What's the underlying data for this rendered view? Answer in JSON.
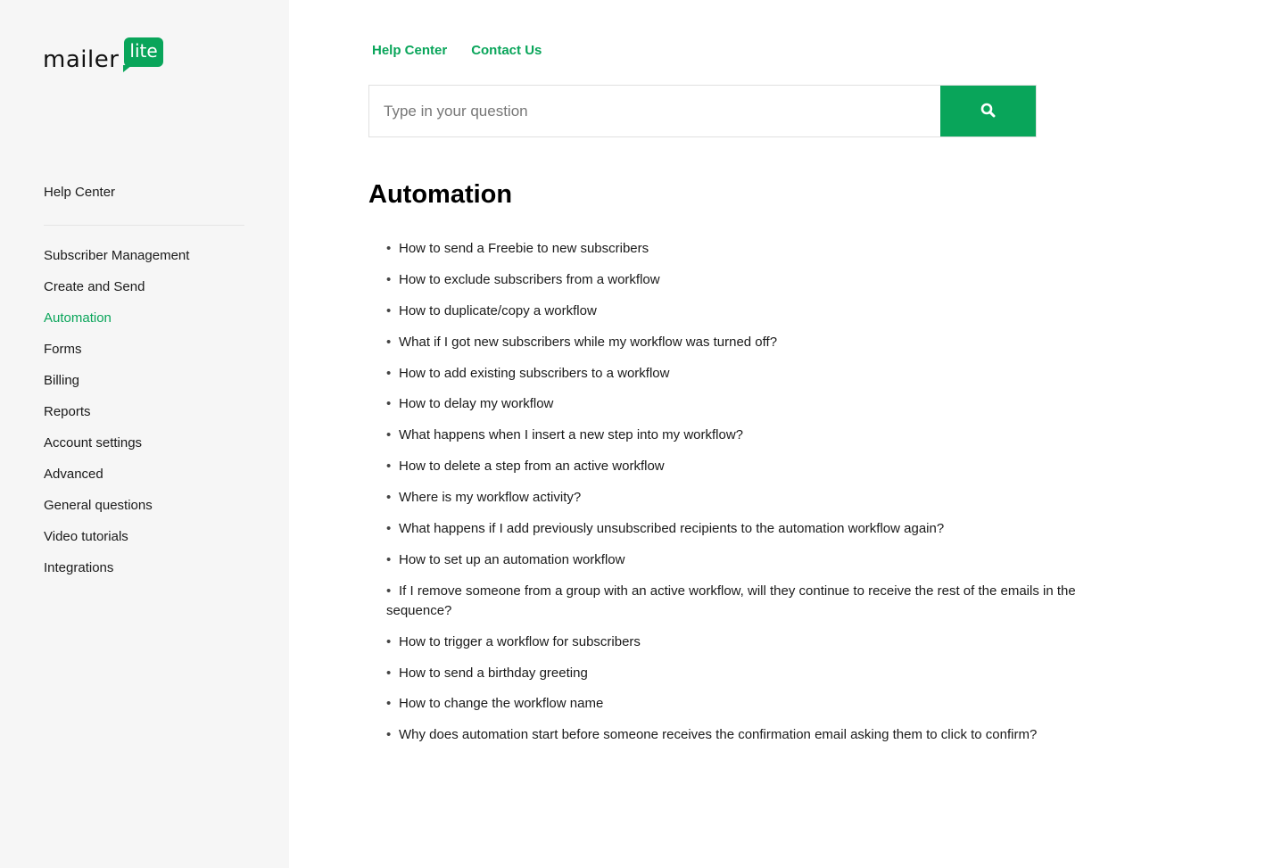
{
  "brand": {
    "word": "mailer",
    "badge": "lite",
    "accent_color": "#09a55a"
  },
  "sidebar": {
    "home_label": "Help Center",
    "items": [
      {
        "label": "Subscriber Management",
        "active": false
      },
      {
        "label": "Create and Send",
        "active": false
      },
      {
        "label": "Automation",
        "active": true
      },
      {
        "label": "Forms",
        "active": false
      },
      {
        "label": "Billing",
        "active": false
      },
      {
        "label": "Reports",
        "active": false
      },
      {
        "label": "Account settings",
        "active": false
      },
      {
        "label": "Advanced",
        "active": false
      },
      {
        "label": "General questions",
        "active": false
      },
      {
        "label": "Video tutorials",
        "active": false
      },
      {
        "label": "Integrations",
        "active": false
      }
    ]
  },
  "header": {
    "links": [
      "Help Center",
      "Contact Us"
    ]
  },
  "search": {
    "placeholder": "Type in your question",
    "value": "",
    "button_icon": "search-icon"
  },
  "main": {
    "title": "Automation",
    "articles": [
      "How to send a Freebie to new subscribers",
      "How to exclude subscribers from a workflow",
      "How to duplicate/copy a workflow",
      "What if I got new subscribers while my workflow was turned off?",
      "How to add existing subscribers to a workflow",
      "How to delay my workflow",
      "What happens when I insert a new step into my workflow?",
      "How to delete a step from an active workflow",
      "Where is my workflow activity?",
      "What happens if I add previously unsubscribed recipients to the automation workflow again?",
      "How to set up an automation workflow",
      "If I remove someone from a group with an active workflow, will they continue to receive the rest of the emails in the sequence?",
      "How to trigger a workflow for subscribers",
      "How to send a birthday greeting",
      "How to change the workflow name",
      "Why does automation start before someone receives the confirmation email asking them to click to confirm?"
    ]
  }
}
